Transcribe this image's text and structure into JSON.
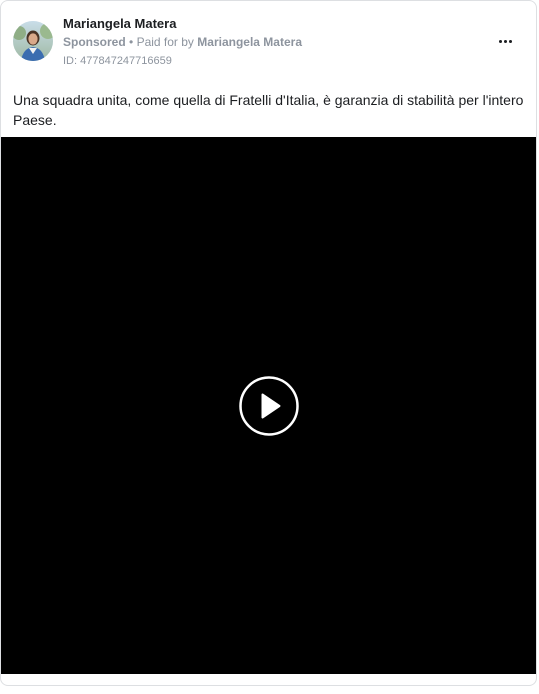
{
  "post": {
    "author_name": "Mariangela Matera",
    "sponsored_label": "Sponsored",
    "separator": "•",
    "paid_for_prefix": "Paid for by",
    "paid_for_name": "Mariangela Matera",
    "ad_id": "ID: 477847247716659",
    "more_icon": "more-horizontal-icon",
    "text": "Una squadra unita, come quella di Fratelli d'Italia, è garanzia di stabilità per l'intero Paese."
  },
  "video": {
    "play_icon": "play-icon",
    "background_color": "#000000"
  },
  "colors": {
    "border": "#dddfe2",
    "secondary_text": "#8d949e",
    "primary_text": "#1c1e21"
  }
}
